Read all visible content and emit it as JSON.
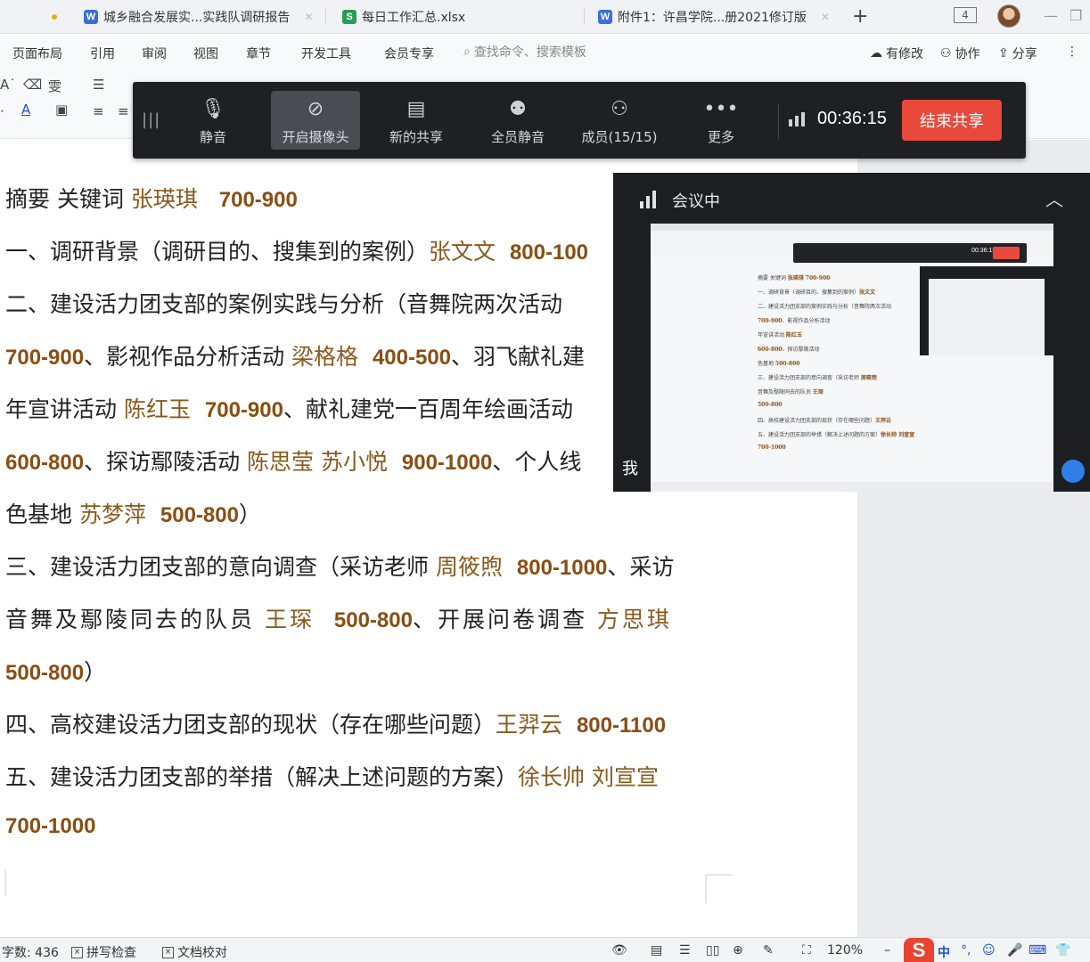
{
  "tabs": [
    {
      "icon": "W",
      "label": "城乡融合发展实...实践队调研报告"
    },
    {
      "icon": "S",
      "label": "每日工作汇总.xlsx"
    },
    {
      "icon": "W",
      "label": "附件1：许昌学院...册2021修订版"
    }
  ],
  "window": {
    "count": "4"
  },
  "ribbon": {
    "menus": [
      "页面布局",
      "引用",
      "审阅",
      "视图",
      "章节",
      "开发工具",
      "会员专享"
    ],
    "search_placeholder": "查找命令、搜索模板",
    "right": [
      "有修改",
      "协作",
      "分享"
    ]
  },
  "meeting_bar": {
    "buttons": [
      "静音",
      "开启摄像头",
      "新的共享",
      "全员静音",
      "成员(15/15)",
      "更多"
    ],
    "timer": "00:36:15",
    "end_share": "结束共享"
  },
  "meeting_window": {
    "title": "会议中",
    "me_label": "我",
    "mini_timer": "00:36:15"
  },
  "document": {
    "lines": [
      {
        "t": "摘要 关键词 ",
        "n": "张瑛琪",
        "r": "700-900"
      },
      {
        "t": "一、调研背景（调研目的、搜集到的案例）",
        "n": "张文文",
        "r": "800-100"
      },
      {
        "t": "二、建设活力团支部的案例实践与分析（音舞院两次活动"
      },
      {
        "r0": "700-900",
        "t": "、影视作品分析活动 ",
        "n": "梁格格",
        "r": "400-500",
        "t2": "、羽飞献礼建"
      },
      {
        "t": "年宣讲活动 ",
        "n": "陈红玉",
        "r": "700-900",
        "t2": "、献礼建党一百周年绘画活动"
      },
      {
        "r0": "600-800",
        "t": "、探访鄢陵活动 ",
        "n": "陈思莹 苏小悦",
        "r": "900-1000",
        "t2": "、个人线"
      },
      {
        "t": "色基地 ",
        "n": "苏梦萍",
        "r": "500-800",
        "t2": "）"
      },
      {
        "t": "三、建设活力团支部的意向调查（采访老师 ",
        "n": "周筱煦",
        "r": "800-1000",
        "t2": "、采访"
      },
      {
        "t": "音舞及鄢陵同去的队员 ",
        "n": "王琛",
        "r": "500-800",
        "t2": "、开展问卷调查 ",
        "n2": "方思琪"
      },
      {
        "r0": "500-800",
        "t": "）"
      },
      {
        "t": "四、高校建设活力团支部的现状（存在哪些问题）",
        "n": "王羿云",
        "r": "800-1100"
      },
      {
        "t": "五、建设活力团支部的举措（解决上述问题的方案）",
        "n": "徐长帅 刘宣宣"
      },
      {
        "r0": "700-1000"
      }
    ]
  },
  "statusbar": {
    "word_count": "字数: 436",
    "spell_check": "拼写检查",
    "doc_check": "文档校对",
    "zoom": "120%",
    "ime": "中"
  },
  "colors": {
    "name_text": "#8a5a1d",
    "range_text": "#8a4e12",
    "end_share_bg": "#e8493a",
    "meeting_bg": "#1f2023"
  }
}
